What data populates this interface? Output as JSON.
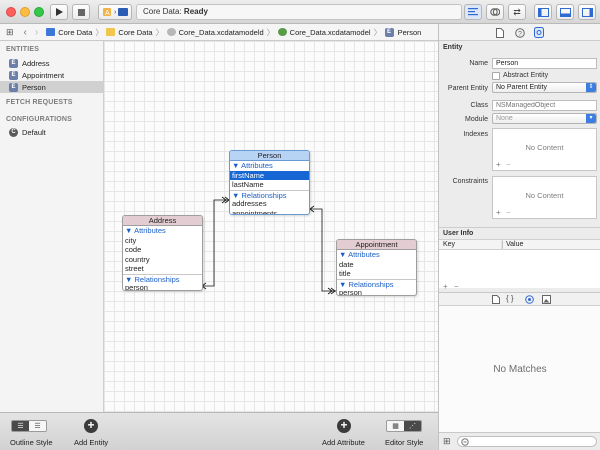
{
  "toolbar": {
    "status_prefix": "Core Data:",
    "status_state": "Ready",
    "colors": {
      "close": "#fc605c",
      "minimize": "#fdbc40",
      "zoom": "#34c84a"
    }
  },
  "jumpbar": {
    "crumbs": [
      "Core Data",
      "Core Data",
      "Core_Data.xcdatamodeld",
      "Core_Data.xcdatamodel",
      "Person"
    ]
  },
  "sidebar": {
    "entities_header": "ENTITIES",
    "entities": [
      "Address",
      "Appointment",
      "Person"
    ],
    "selected_entity": "Person",
    "fetch_header": "FETCH REQUESTS",
    "config_header": "CONFIGURATIONS",
    "configurations": [
      "Default"
    ]
  },
  "diagram": {
    "person": {
      "name": "Person",
      "attributes_label": "▼ Attributes",
      "attributes": [
        "firstName",
        "lastName"
      ],
      "selected_attribute": "firstName",
      "relationships_label": "▼ Relationships",
      "relationships": [
        "addresses",
        "appointments"
      ]
    },
    "address": {
      "name": "Address",
      "attributes_label": "▼ Attributes",
      "attributes": [
        "city",
        "code",
        "country",
        "street"
      ],
      "relationships_label": "▼ Relationships",
      "relationships": [
        "person"
      ]
    },
    "appointment": {
      "name": "Appointment",
      "attributes_label": "▼ Attributes",
      "attributes": [
        "date",
        "title"
      ],
      "relationships_label": "▼ Relationships",
      "relationships": [
        "person"
      ]
    },
    "colors": {
      "person_header": "#b8d4f5",
      "other_header": "#e3cdd2",
      "selection": "#1667d3"
    }
  },
  "bottombar": {
    "outline_style": "Outline Style",
    "add_entity": "Add Entity",
    "add_attribute": "Add Attribute",
    "editor_style": "Editor Style"
  },
  "inspector": {
    "section_entity": "Entity",
    "name_label": "Name",
    "name_value": "Person",
    "abstract_label": "Abstract Entity",
    "parent_label": "Parent Entity",
    "parent_value": "No Parent Entity",
    "class_label": "Class",
    "class_placeholder": "NSManagedObject",
    "module_label": "Module",
    "module_value": "None",
    "indexes_label": "Indexes",
    "indexes_empty": "No Content",
    "constraints_label": "Constraints",
    "constraints_empty": "No Content",
    "user_info_header": "User Info",
    "key_col": "Key",
    "value_col": "Value",
    "no_matches": "No Matches"
  }
}
